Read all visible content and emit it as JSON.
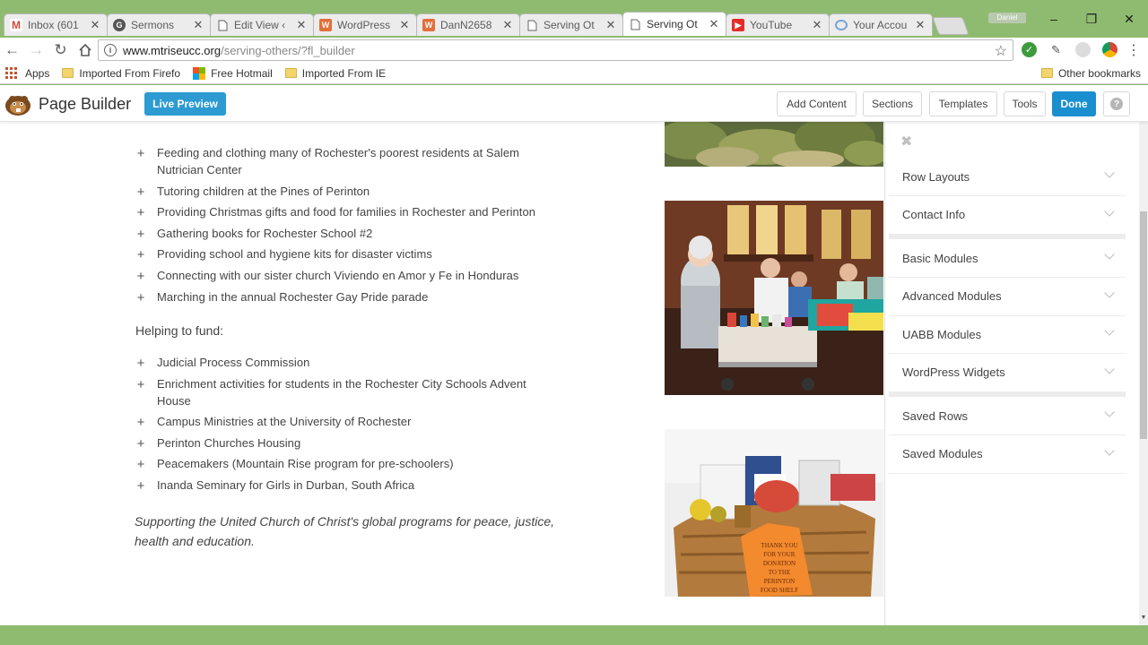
{
  "browser": {
    "tabs": [
      {
        "title": "Inbox (601",
        "favicon": "gmail-icon",
        "color": "#d54b3d",
        "glyph": "M",
        "active": false
      },
      {
        "title": "Sermons",
        "favicon": "google-icon",
        "color": "#555555",
        "glyph": "G",
        "active": false
      },
      {
        "title": "Edit View ‹",
        "favicon": "page-icon",
        "color": "",
        "glyph": "",
        "active": false
      },
      {
        "title": "WordPress",
        "favicon": "wordpress-icon",
        "color": "#e2703a",
        "glyph": "W",
        "active": false
      },
      {
        "title": "DanN2658",
        "favicon": "wordpress-icon",
        "color": "#e2703a",
        "glyph": "W",
        "active": false
      },
      {
        "title": "Serving Ot",
        "favicon": "page-icon",
        "color": "",
        "glyph": "",
        "active": false
      },
      {
        "title": "Serving Ot",
        "favicon": "page-icon",
        "color": "",
        "glyph": "",
        "active": true
      },
      {
        "title": "YouTube",
        "favicon": "youtube-icon",
        "color": "#e52d27",
        "glyph": "▶",
        "active": false
      },
      {
        "title": "Your Accou",
        "favicon": "loading-icon",
        "color": "#7aa3d6",
        "glyph": "",
        "active": false
      }
    ],
    "profile_label": "Daniel",
    "url_host": "www.mtriseucc.org",
    "url_path": "/serving-others/?fl_builder",
    "bookmarks": {
      "apps": "Apps",
      "items": [
        "Imported From Firefo",
        "Free Hotmail",
        "Imported From IE"
      ],
      "other": "Other bookmarks"
    }
  },
  "builder": {
    "title": "Page Builder",
    "live_preview": "Live Preview",
    "buttons": {
      "add_content": "Add Content",
      "sections": "Sections",
      "templates": "Templates",
      "tools": "Tools",
      "done": "Done",
      "help": "?"
    },
    "colors": {
      "primary": "#1a8fd0",
      "live_preview": "#2d9bd2"
    }
  },
  "page": {
    "list_serving": [
      "Feeding and clothing many of Rochester's poorest residents at Salem Nutrician Center",
      "Tutoring children at the Pines of Perinton",
      "Providing Christmas gifts and food for families in Rochester and Perinton",
      "Gathering books for Rochester School #2",
      "Providing school and hygiene kits for disaster victims",
      "Connecting with our sister church Viviendo en Amor y Fe in Honduras",
      "Marching in the annual Rochester Gay Pride parade"
    ],
    "helping_heading": "Helping to fund:",
    "list_funding": [
      "Judicial Process Commission",
      "Enrichment activities for students in the Rochester City Schools Advent House",
      "Campus Ministries at the University of Rochester",
      "Perinton Churches Housing",
      "Peacemakers (Mountain Rise program for pre-schoolers)",
      "Inanda Seminary for Girls in Durban, South Africa"
    ],
    "tagline": "Supporting the United Church of Christ's global programs for peace, justice, health and education.",
    "bullet_glyph": "+",
    "basket_note": "THANK YOU FOR YOUR DONATION TO THE PERINTON FOOD SHELF"
  },
  "panel": {
    "close_glyph": "✖",
    "sections_group1": [
      "Row Layouts",
      "Contact Info"
    ],
    "sections_group2": [
      "Basic Modules",
      "Advanced Modules",
      "UABB Modules",
      "WordPress Widgets"
    ],
    "sections_group3": [
      "Saved Rows",
      "Saved Modules"
    ]
  }
}
